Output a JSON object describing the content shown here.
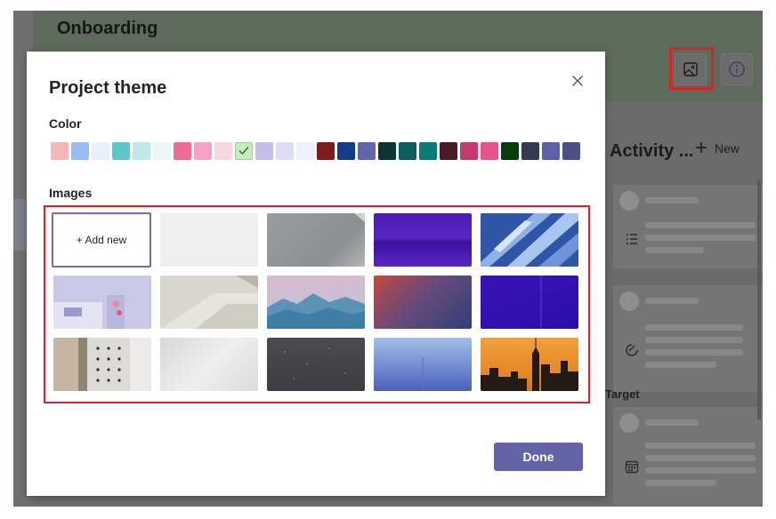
{
  "app": {
    "title": "Onboarding"
  },
  "activity": {
    "title": "Activity ...",
    "new_label": "New"
  },
  "side": {
    "target_label": "Target"
  },
  "modal": {
    "title": "Project theme",
    "color_label": "Color",
    "images_label": "Images",
    "add_new_label": "+ Add new",
    "done_label": "Done"
  },
  "colors": [
    {
      "hex": "#f4b7b6"
    },
    {
      "hex": "#9bbdf5"
    },
    {
      "hex": "#e8effc"
    },
    {
      "hex": "#5fc6c8"
    },
    {
      "hex": "#bfe8e8"
    },
    {
      "hex": "#edf7f7"
    },
    {
      "hex": "#ee6b99"
    },
    {
      "hex": "#f4a2c5"
    },
    {
      "hex": "#f6d6df"
    },
    {
      "hex": "#c8ebbf",
      "selected": true
    },
    {
      "hex": "#c3bfe8"
    },
    {
      "hex": "#dcdcf3"
    },
    {
      "hex": "#eff0fa"
    },
    {
      "hex": "#7b1b1f"
    },
    {
      "hex": "#103e8c"
    },
    {
      "hex": "#6465a8"
    },
    {
      "hex": "#0b3433"
    },
    {
      "hex": "#085f5c"
    },
    {
      "hex": "#0a7a78"
    },
    {
      "hex": "#4a1a26"
    },
    {
      "hex": "#c33a6e"
    },
    {
      "hex": "#e8528d"
    },
    {
      "hex": "#073c0d"
    },
    {
      "hex": "#353a52"
    },
    {
      "hex": "#5d5fa8"
    },
    {
      "hex": "#4d5086"
    }
  ],
  "images": [
    {
      "name": "light-gray"
    },
    {
      "name": "gray-paper"
    },
    {
      "name": "purple-waves"
    },
    {
      "name": "blue-glass"
    },
    {
      "name": "pink-flowers"
    },
    {
      "name": "beige-shapes"
    },
    {
      "name": "mountains"
    },
    {
      "name": "red-blue-gradient"
    },
    {
      "name": "deep-purple"
    },
    {
      "name": "pegboard"
    },
    {
      "name": "soft-white-waves"
    },
    {
      "name": "dark-night-sky"
    },
    {
      "name": "blue-sky"
    },
    {
      "name": "city-sunset"
    }
  ],
  "icons": {
    "header_image": "image-icon",
    "header_info": "info-icon",
    "close": "close-icon",
    "check": "check-icon",
    "list": "list-icon",
    "status": "status-icon",
    "calendar": "calendar-icon"
  }
}
